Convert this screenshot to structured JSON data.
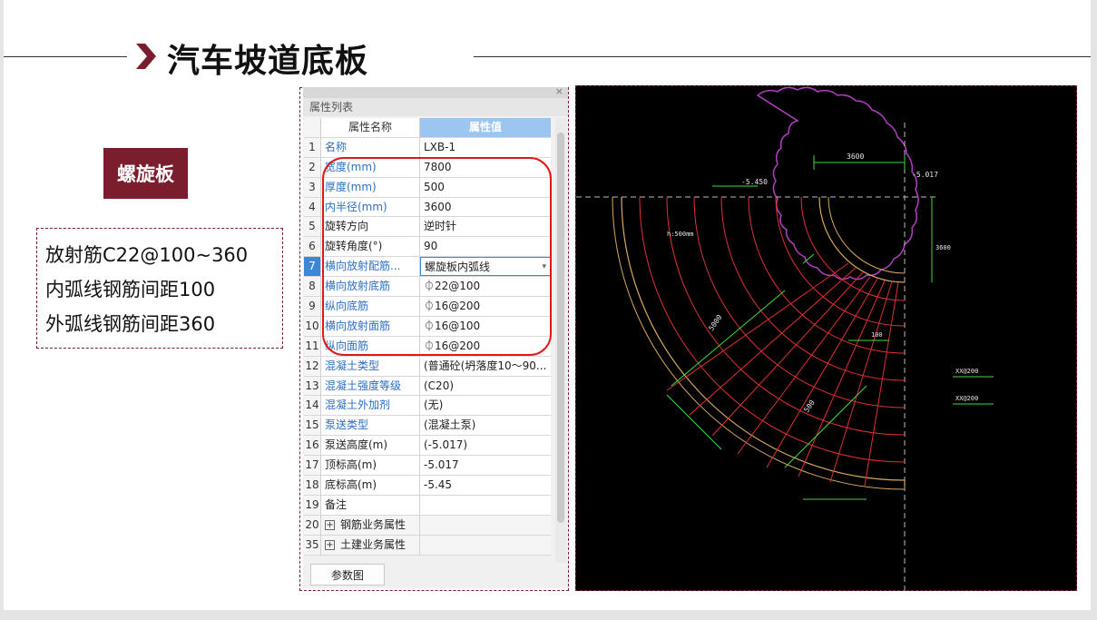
{
  "title": "汽车坡道底板",
  "badge": "螺旋板",
  "notes": [
    "放射筋C22@100~360",
    "内弧线钢筋间距100",
    "外弧线钢筋间距360"
  ],
  "panel": {
    "caption": "属性列表",
    "close": "×",
    "header": {
      "name": "属性名称",
      "value": "属性值"
    },
    "rows": [
      {
        "num": "1",
        "name": "名称",
        "value": "LXB-1"
      },
      {
        "num": "2",
        "name": "宽度(mm)",
        "value": "7800"
      },
      {
        "num": "3",
        "name": "厚度(mm)",
        "value": "500"
      },
      {
        "num": "4",
        "name": "内半径(mm)",
        "value": "3600"
      },
      {
        "num": "5",
        "name": "旋转方向",
        "value": "逆时针"
      },
      {
        "num": "6",
        "name": "旋转角度(°)",
        "value": "90"
      },
      {
        "num": "7",
        "name": "横向放射配筋...",
        "value": "螺旋板内弧线"
      },
      {
        "num": "8",
        "name": "横向放射底筋",
        "value": "⏀22@100"
      },
      {
        "num": "9",
        "name": "纵向底筋",
        "value": "⏀16@200"
      },
      {
        "num": "10",
        "name": "横向放射面筋",
        "value": "⏀16@100"
      },
      {
        "num": "11",
        "name": "纵向面筋",
        "value": "⏀16@200"
      },
      {
        "num": "12",
        "name": "混凝土类型",
        "value": "(普通砼(坍落度10～90..."
      },
      {
        "num": "13",
        "name": "混凝土强度等级",
        "value": "(C20)"
      },
      {
        "num": "14",
        "name": "混凝土外加剂",
        "value": "(无)"
      },
      {
        "num": "15",
        "name": "泵送类型",
        "value": "(混凝土泵)"
      },
      {
        "num": "16",
        "name": "泵送高度(m)",
        "value": "(-5.017)"
      },
      {
        "num": "17",
        "name": "顶标高(m)",
        "value": "-5.017"
      },
      {
        "num": "18",
        "name": "底标高(m)",
        "value": "-5.45"
      },
      {
        "num": "19",
        "name": "备注",
        "value": ""
      },
      {
        "num": "20",
        "name": "钢筋业务属性",
        "value": ""
      },
      {
        "num": "35",
        "name": "土建业务属性",
        "value": ""
      }
    ],
    "param_button": "参数图"
  },
  "cad": {
    "dim_top": "3600",
    "elev_left": "-5.450",
    "elev_right": "-5.017",
    "h_label": "h:500mm",
    "dim_side": "3600",
    "dim_5000_a": "5000",
    "dim_5000_b": "500",
    "note_right_1": "XX@200",
    "note_right_2": "XX@200",
    "spacing_100": "100"
  },
  "colors": {
    "accent": "#7a1e2e",
    "highlight": "#e01818",
    "header_blue": "#9cc6f0",
    "cad_rebar": "#e03030",
    "cad_dim": "#3ddc3d",
    "cad_cloud": "#b040c0",
    "cad_edge": "#d8a860"
  }
}
